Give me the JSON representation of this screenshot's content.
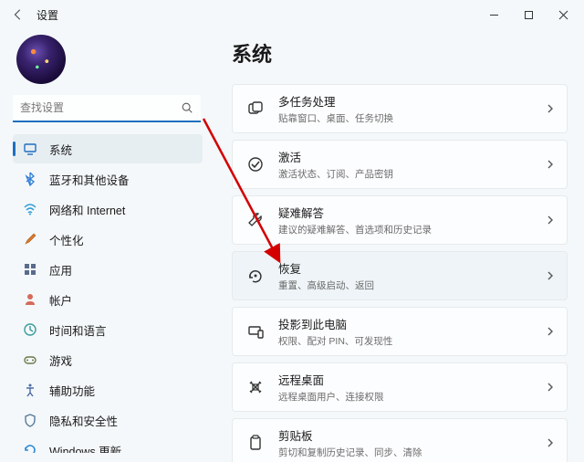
{
  "window": {
    "title": "设置"
  },
  "search": {
    "placeholder": "查找设置"
  },
  "nav": [
    {
      "id": "system",
      "label": "系统",
      "icon": "system",
      "active": true
    },
    {
      "id": "bluetooth",
      "label": "蓝牙和其他设备",
      "icon": "bluetooth"
    },
    {
      "id": "network",
      "label": "网络和 Internet",
      "icon": "wifi"
    },
    {
      "id": "personalize",
      "label": "个性化",
      "icon": "brush"
    },
    {
      "id": "apps",
      "label": "应用",
      "icon": "apps"
    },
    {
      "id": "accounts",
      "label": "帐户",
      "icon": "person"
    },
    {
      "id": "timelang",
      "label": "时间和语言",
      "icon": "clock"
    },
    {
      "id": "gaming",
      "label": "游戏",
      "icon": "game"
    },
    {
      "id": "accessibility",
      "label": "辅助功能",
      "icon": "access"
    },
    {
      "id": "privacy",
      "label": "隐私和安全性",
      "icon": "shield"
    },
    {
      "id": "update",
      "label": "Windows 更新",
      "icon": "update"
    }
  ],
  "page": {
    "title": "系统",
    "items": [
      {
        "id": "multitask",
        "title": "多任务处理",
        "desc": "贴靠窗口、桌面、任务切换",
        "icon": "multitask"
      },
      {
        "id": "activation",
        "title": "激活",
        "desc": "激活状态、订阅、产品密钥",
        "icon": "check"
      },
      {
        "id": "troubleshoot",
        "title": "疑难解答",
        "desc": "建议的疑难解答、首选项和历史记录",
        "icon": "wrench"
      },
      {
        "id": "recovery",
        "title": "恢复",
        "desc": "重置、高级启动、返回",
        "icon": "recovery",
        "highlight": true
      },
      {
        "id": "project",
        "title": "投影到此电脑",
        "desc": "权限、配对 PIN、可发现性",
        "icon": "project"
      },
      {
        "id": "remote",
        "title": "远程桌面",
        "desc": "远程桌面用户、连接权限",
        "icon": "remote"
      },
      {
        "id": "clipboard",
        "title": "剪贴板",
        "desc": "剪切和复制历史记录、同步、清除",
        "icon": "clipboard"
      }
    ]
  }
}
